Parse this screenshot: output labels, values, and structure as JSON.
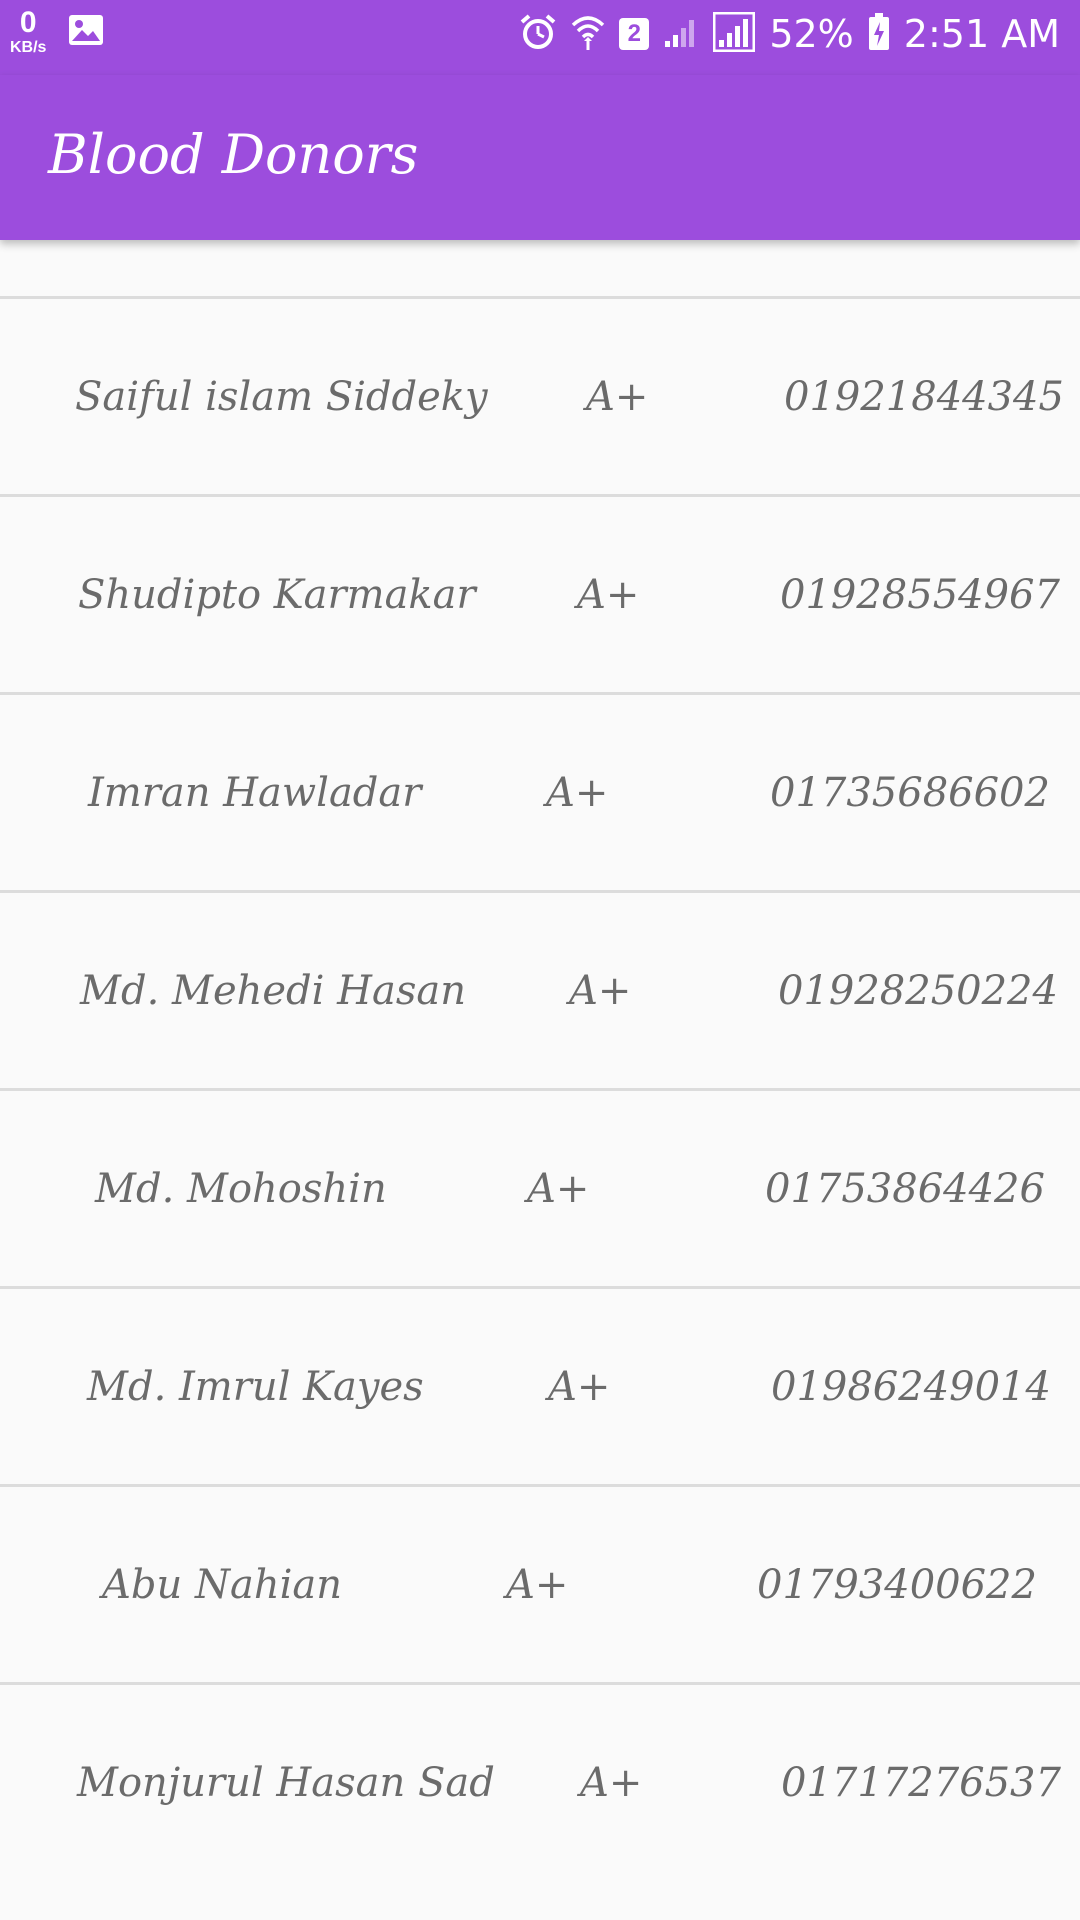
{
  "status_bar": {
    "speed_value": "0",
    "speed_unit": "KB/s",
    "sim_slot": "2",
    "battery": "52%",
    "time": "2:51 AM"
  },
  "app_bar": {
    "title": "Blood Donors"
  },
  "colors": {
    "primary": "#9c4ddd",
    "background": "#fafafa",
    "text": "#6b6b6b",
    "divider": "#dcdcdc"
  },
  "donors": [
    {
      "name": "Saiful islam Siddeky",
      "group": "A+",
      "phone": "01921844345"
    },
    {
      "name": "Shudipto Karmakar",
      "group": "A+",
      "phone": "01928554967"
    },
    {
      "name": "Imran Hawladar",
      "group": "A+",
      "phone": "01735686602"
    },
    {
      "name": "Md. Mehedi Hasan",
      "group": "A+",
      "phone": "01928250224"
    },
    {
      "name": "Md. Mohoshin",
      "group": "A+",
      "phone": "01753864426"
    },
    {
      "name": "Md. Imrul Kayes",
      "group": "A+",
      "phone": "01986249014"
    },
    {
      "name": "Abu Nahian",
      "group": "A+",
      "phone": "01793400622"
    },
    {
      "name": "Monjurul Hasan Sad",
      "group": "A+",
      "phone": "01717276537"
    }
  ]
}
